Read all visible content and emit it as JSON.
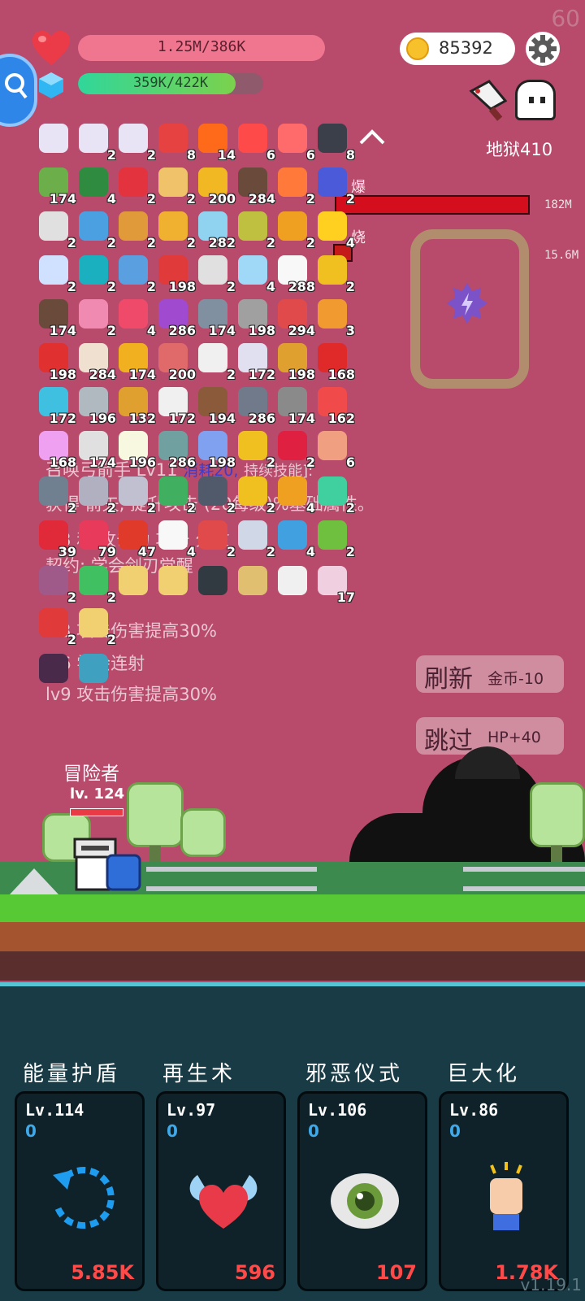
{
  "fps": "60",
  "player": {
    "hp_text": "1.25M/386K",
    "xp_text": "359K/422K",
    "xp_progress": 0.85,
    "coins": "85392"
  },
  "boss": {
    "stage": "地狱410",
    "bar1_value": "182M",
    "bar2_value": "15.6M",
    "burst_label": "爆",
    "burn_label": "烧"
  },
  "items": [
    {
      "icon": "scroll-pink-icon",
      "count": "",
      "color": "#e8e3f5"
    },
    {
      "icon": "scroll-pink-icon",
      "count": "2",
      "color": "#e8e3f5"
    },
    {
      "icon": "scroll-pink-icon",
      "count": "2",
      "color": "#e8e3f5"
    },
    {
      "icon": "map-pin-icon",
      "count": "8",
      "color": "#e64242"
    },
    {
      "icon": "fire-icon",
      "count": "14",
      "color": "#ff6a1a"
    },
    {
      "icon": "heat-waves-icon",
      "count": "6",
      "color": "#ff4a4a"
    },
    {
      "icon": "thermometer-icon",
      "count": "6",
      "color": "#ff6a6a"
    },
    {
      "icon": "bomb-icon",
      "count": "8",
      "color": "#3a3f4a"
    },
    {
      "icon": "chevron-up-icon",
      "count": "",
      "color": "transparent"
    },
    {
      "icon": "heart-envelope-icon",
      "count": "174",
      "color": "#6cae4a"
    },
    {
      "icon": "witch-hat-icon",
      "count": "4",
      "color": "#2e8b40"
    },
    {
      "icon": "magnet-icon",
      "count": "2",
      "color": "#e2333f"
    },
    {
      "icon": "scroll-icon",
      "count": "2",
      "color": "#f0c36a"
    },
    {
      "icon": "gold-coins-icon",
      "count": "200",
      "color": "#f2b824"
    },
    {
      "icon": "pirate-ship-icon",
      "count": "284",
      "color": "#6a4a3a"
    },
    {
      "icon": "flame-ring-icon",
      "count": "2",
      "color": "#ff7a3a"
    },
    {
      "icon": "wizard-hat-icon",
      "count": "2",
      "color": "#4a5ad8"
    },
    {
      "icon": "sparkle-icon",
      "count": "2",
      "color": "#e0e0e0"
    },
    {
      "icon": "star-card-icon",
      "count": "2",
      "color": "#4aa0e0"
    },
    {
      "icon": "briefcase-icon",
      "count": "2",
      "color": "#e09a3a"
    },
    {
      "icon": "x-map-icon",
      "count": "2",
      "color": "#f0b030"
    },
    {
      "icon": "helmet-icon",
      "count": "282",
      "color": "#8fd3f0"
    },
    {
      "icon": "pineapple-icon",
      "count": "2",
      "color": "#c0c040"
    },
    {
      "icon": "pineapple-small-icon",
      "count": "2",
      "color": "#f0a020"
    },
    {
      "icon": "sun-orb-icon",
      "count": "4",
      "color": "#ffd020"
    },
    {
      "icon": "speed-lines-icon",
      "count": "2",
      "color": "#d0e0ff"
    },
    {
      "icon": "portal-icon",
      "count": "2",
      "color": "#1ab0c0"
    },
    {
      "icon": "coat-icon",
      "count": "2",
      "color": "#5aa0e0"
    },
    {
      "icon": "watermelon-icon",
      "count": "198",
      "color": "#e03a3a"
    },
    {
      "icon": "lightbulb-icon",
      "count": "2",
      "color": "#e0e0e0"
    },
    {
      "icon": "ice-block-icon",
      "count": "4",
      "color": "#a0d8f8"
    },
    {
      "icon": "ghost-icon",
      "count": "288",
      "color": "#f8f8f8"
    },
    {
      "icon": "crown-icon",
      "count": "2",
      "color": "#f0c020"
    },
    {
      "icon": "coconut-icon",
      "count": "174",
      "color": "#6a4a3a"
    },
    {
      "icon": "ice-cream-icon",
      "count": "2",
      "color": "#f08ab0"
    },
    {
      "icon": "peach-icon",
      "count": "4",
      "color": "#f04a6a"
    },
    {
      "icon": "flower-icon",
      "count": "286",
      "color": "#a04ad0"
    },
    {
      "icon": "elephant-icon",
      "count": "174",
      "color": "#8090a0"
    },
    {
      "icon": "arrows-icon",
      "count": "198",
      "color": "#a0a0a0"
    },
    {
      "icon": "jar-icon",
      "count": "294",
      "color": "#e04a4a"
    },
    {
      "icon": "scroll-orange-icon",
      "count": "3",
      "color": "#f09a30"
    },
    {
      "icon": "red-cup-icon",
      "count": "198",
      "color": "#e03030"
    },
    {
      "icon": "cake-icon",
      "count": "284",
      "color": "#f0e0d0"
    },
    {
      "icon": "sunflower-icon",
      "count": "174",
      "color": "#f0b020"
    },
    {
      "icon": "meat-icon",
      "count": "200",
      "color": "#e06a6a"
    },
    {
      "icon": "cards-icon",
      "count": "2",
      "color": "#f0f0f0"
    },
    {
      "icon": "potion-icon",
      "count": "172",
      "color": "#e0e0f0"
    },
    {
      "icon": "book-icon",
      "count": "198",
      "color": "#e0a030"
    },
    {
      "icon": "red-card-icon",
      "count": "168",
      "color": "#e02a2a"
    },
    {
      "icon": "sword-icon",
      "count": "172",
      "color": "#40c0e0"
    },
    {
      "icon": "blade-icon",
      "count": "196",
      "color": "#b0b8c0"
    },
    {
      "icon": "bread-icon",
      "count": "132",
      "color": "#e0a030"
    },
    {
      "icon": "dice-icon",
      "count": "172",
      "color": "#f0f0f0"
    },
    {
      "icon": "donut-icon",
      "count": "194",
      "color": "#8a5a3a"
    },
    {
      "icon": "spike-ball-icon",
      "count": "286",
      "color": "#707a8a"
    },
    {
      "icon": "dome-icon",
      "count": "174",
      "color": "#8a8a8a"
    },
    {
      "icon": "pill-icon",
      "count": "162",
      "color": "#f04a4a"
    },
    {
      "icon": "rainbow-icon",
      "count": "168",
      "color": "#f0a0f0"
    },
    {
      "icon": "envelope-icon",
      "count": "174",
      "color": "#e0e0e0"
    },
    {
      "icon": "egg-icon",
      "count": "196",
      "color": "#f8f8e0"
    },
    {
      "icon": "vinyl-icon",
      "count": "286",
      "color": "#70a0a0"
    },
    {
      "icon": "eraser-icon",
      "count": "198",
      "color": "#80a0f0"
    },
    {
      "icon": "beer-icon",
      "count": "2",
      "color": "#f0c020"
    },
    {
      "icon": "ruby-icon",
      "count": "2",
      "color": "#e02040"
    },
    {
      "icon": "gold-crown-icon",
      "count": "6",
      "color": "#f0a080"
    },
    {
      "icon": "compass-icon",
      "count": "2",
      "color": "#708090"
    },
    {
      "icon": "crossed-swords-icon",
      "count": "2",
      "color": "#b0b0c0"
    },
    {
      "icon": "hook-icon",
      "count": "2",
      "color": "#c0c0d0"
    },
    {
      "icon": "phone-icon",
      "count": "2",
      "color": "#40b060"
    },
    {
      "icon": "mortar-icon",
      "count": "2",
      "color": "#505a6a"
    },
    {
      "icon": "magic-wand-icon",
      "count": "2",
      "color": "#f0c020"
    },
    {
      "icon": "ring-icon",
      "count": "4",
      "color": "#f0a020"
    },
    {
      "icon": "genie-icon",
      "count": "2",
      "color": "#40d0a0"
    },
    {
      "icon": "strawberry-icon",
      "count": "39",
      "color": "#e02a3a"
    },
    {
      "icon": "big-heart-icon",
      "count": "79",
      "color": "#e83a5a"
    },
    {
      "icon": "apple-icon",
      "count": "47",
      "color": "#e03a2a"
    },
    {
      "icon": "speech-bubble-icon",
      "count": "4",
      "color": "#f8f8f8"
    },
    {
      "icon": "target-icon",
      "count": "2",
      "color": "#e04a4a"
    },
    {
      "icon": "bottle-icon",
      "count": "2",
      "color": "#d0d8e8"
    },
    {
      "icon": "blue-scroll-icon",
      "count": "4",
      "color": "#40a0e0"
    },
    {
      "icon": "lime-icon",
      "count": "2",
      "color": "#70c040"
    },
    {
      "icon": "cogs-icon",
      "count": "2",
      "color": "#a05a8a"
    },
    {
      "icon": "molecule-icon",
      "count": "2",
      "color": "#40c060"
    },
    {
      "icon": "map-icon",
      "count": "",
      "color": "#f0d070"
    },
    {
      "icon": "question-note-icon",
      "count": "",
      "color": "#f0d070"
    },
    {
      "icon": "skull-book-icon",
      "count": "",
      "color": "#303a40"
    },
    {
      "icon": "world-map-icon",
      "count": "",
      "color": "#e0c070"
    },
    {
      "icon": "open-book-icon",
      "count": "",
      "color": "#f0f0f0"
    },
    {
      "icon": "card-17-icon",
      "count": "17",
      "color": "#f0d0e0"
    },
    {
      "icon": "red-shield-icon",
      "count": "2",
      "color": "#e03a3a"
    },
    {
      "icon": "treasure-map-icon",
      "count": "2",
      "color": "#f0d070"
    },
    {
      "icon": "dark-cube-icon",
      "count": "",
      "color": "#4a2a4a"
    },
    {
      "icon": "glow-cube-icon",
      "count": "",
      "color": "#40a0c0"
    }
  ],
  "bg_texts": {
    "line1": "召唤弓箭手 Lv11",
    "line1_hl": "消耗20,",
    "line1_tail": "持续技能]:",
    "line2": "获得 箭矢, 提升攻击 (20每级)%基础属性。",
    "line3": "lv3 和 攻击力 攻击 分散",
    "line4": "契约: 学会剑刃觉醒",
    "line5": "lv3 攻击伤害提高30%",
    "line6": "lv6 学会连射",
    "line7": "lv9 攻击伤害提高30%"
  },
  "buttons": {
    "refresh": "刷新",
    "refresh_cost": "金币-10",
    "skip": "跳过",
    "skip_reward": "HP+40"
  },
  "hero": {
    "name": "冒险者",
    "level": "lv. 124"
  },
  "skills": [
    {
      "title": "能量护盾",
      "level": "Lv.114",
      "value": "0",
      "cost": "5.85K",
      "icon": "refresh-circle-icon"
    },
    {
      "title": "再生术",
      "level": "Lv.97",
      "value": "0",
      "cost": "596",
      "icon": "winged-heart-icon"
    },
    {
      "title": "邪恶仪式",
      "level": "Lv.106",
      "value": "0",
      "cost": "107",
      "icon": "eye-icon"
    },
    {
      "title": "巨大化",
      "level": "Lv.86",
      "value": "0",
      "cost": "1.78K",
      "icon": "raised-fist-icon"
    }
  ],
  "version": "v1.19.1"
}
